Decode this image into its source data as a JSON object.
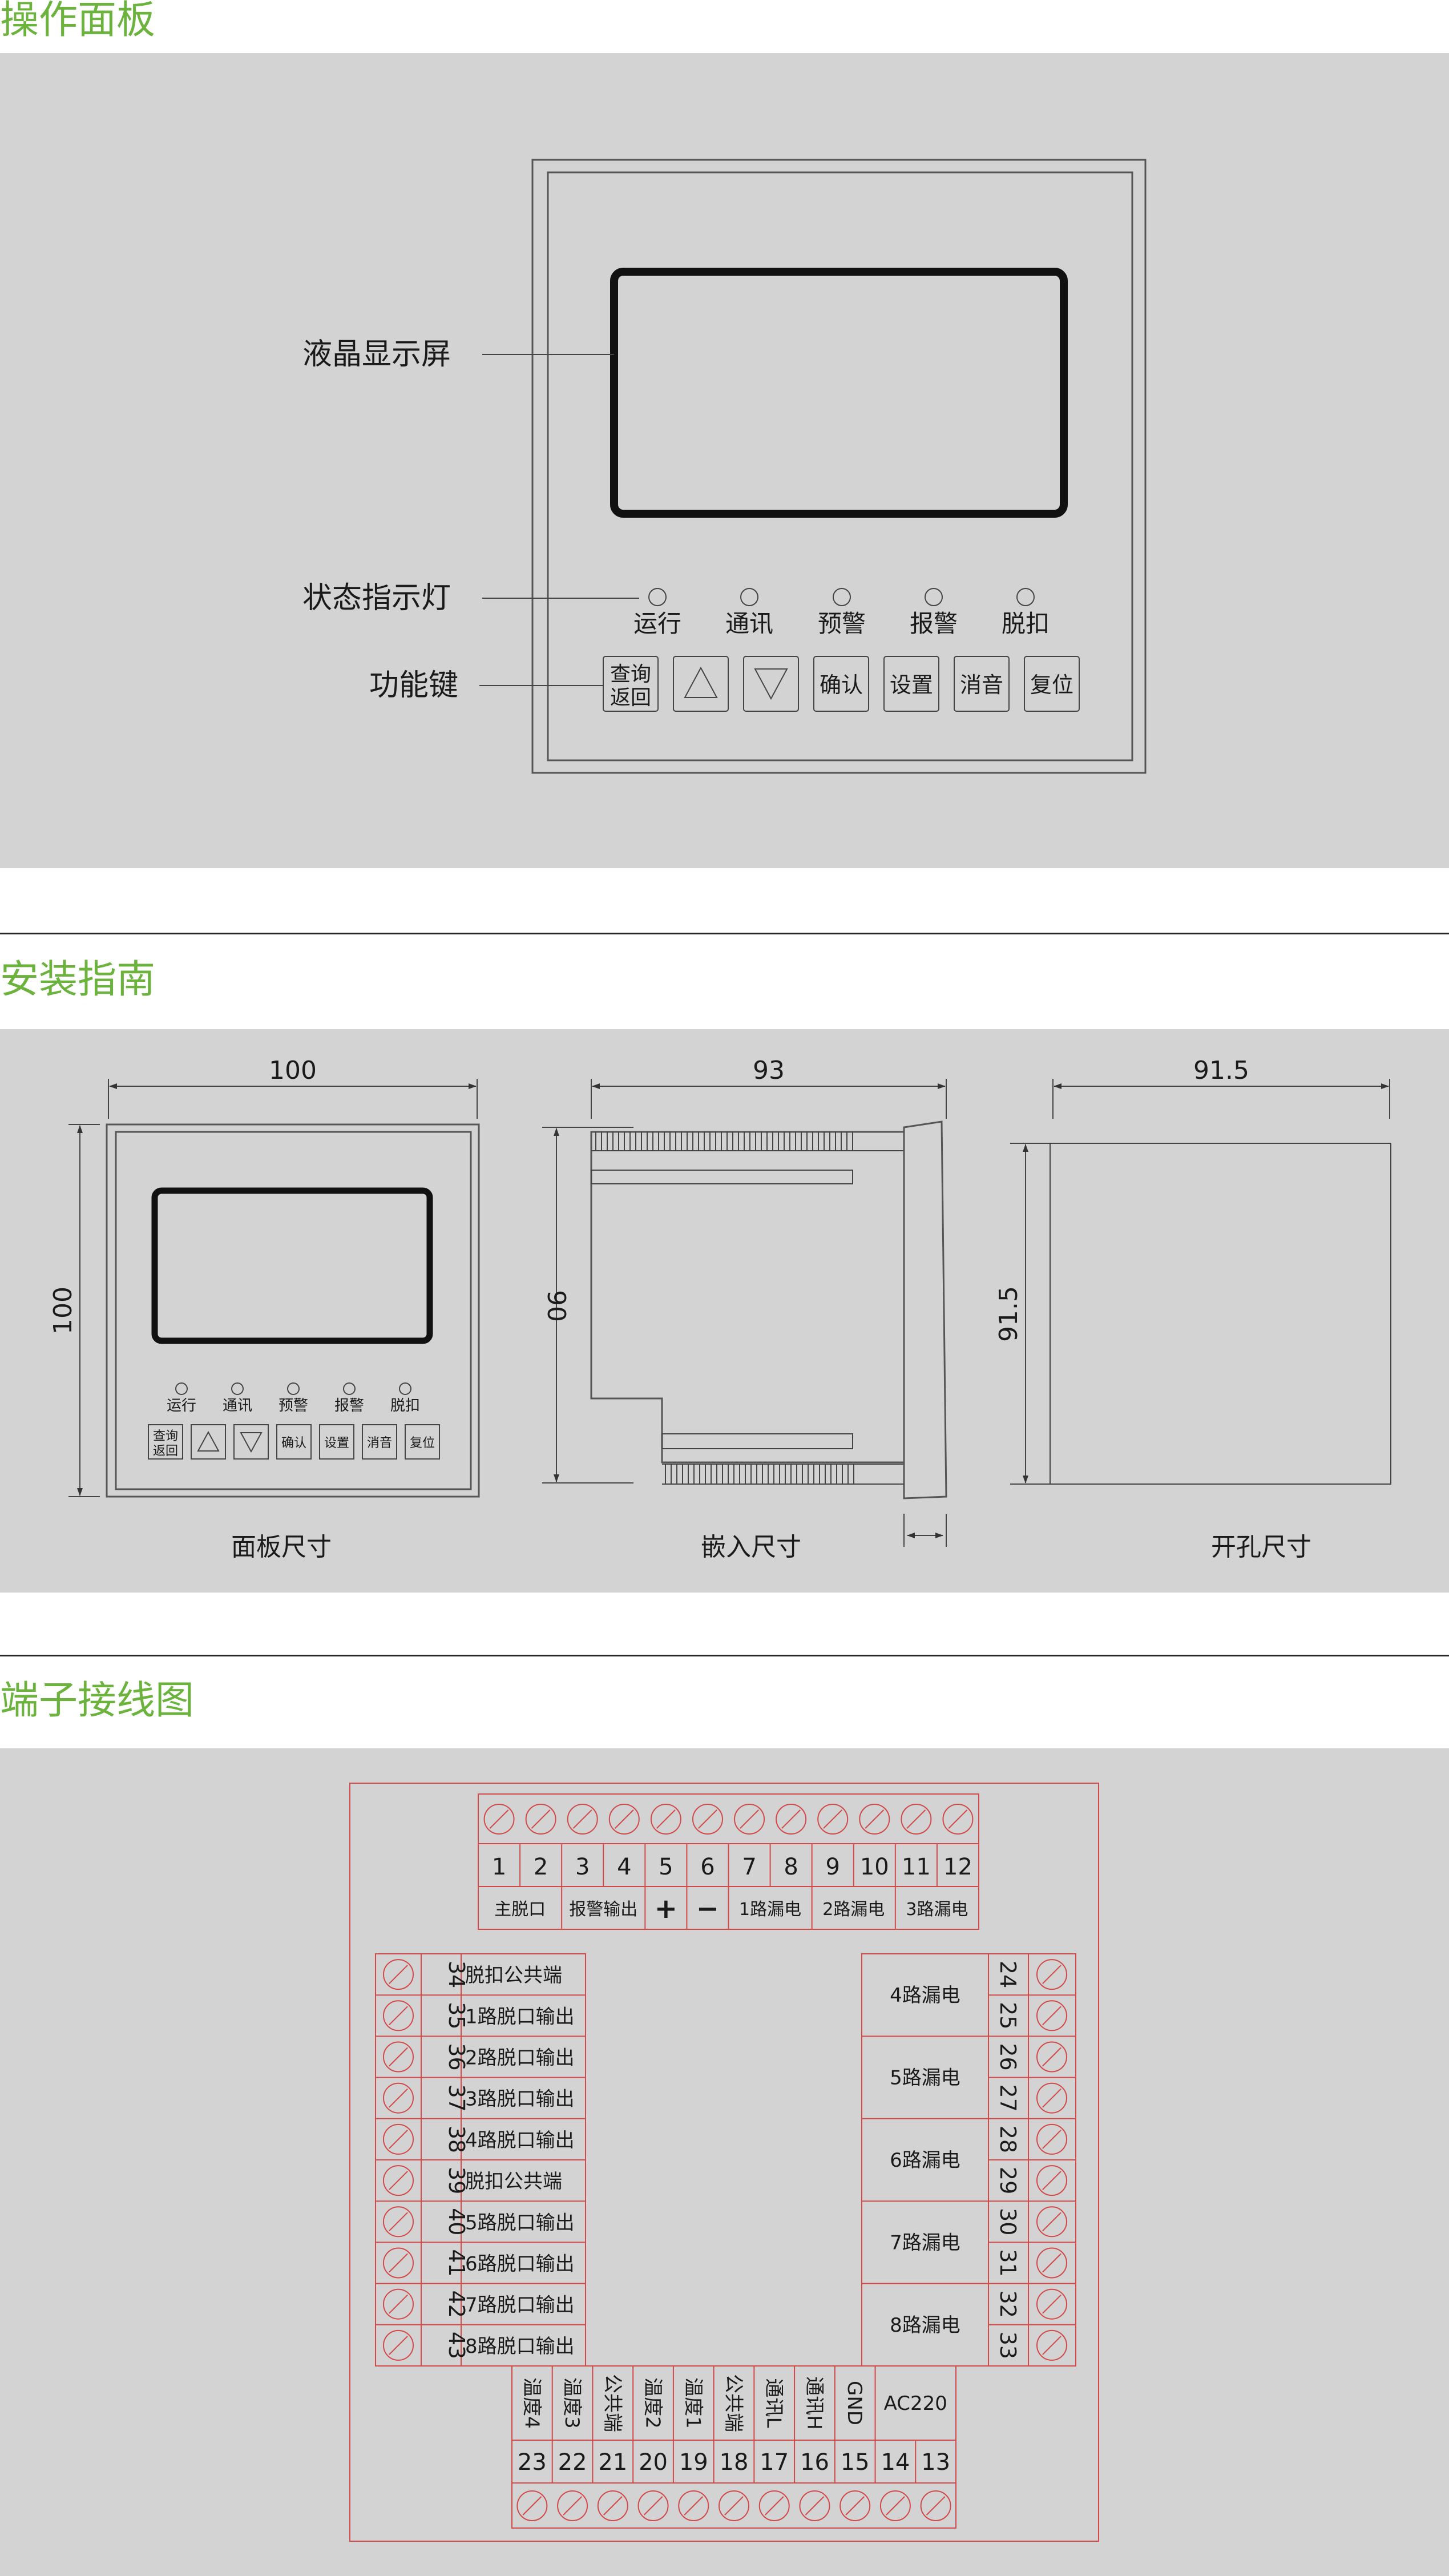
{
  "sections": {
    "panel": "操作面板",
    "install": "安装指南",
    "wiring": "端子接线图"
  },
  "panel": {
    "lcd_label": "液晶显示屏",
    "indicator_label": "状态指示灯",
    "keys_label": "功能键",
    "indicators": [
      "运行",
      "通讯",
      "预警",
      "报警",
      "脱扣"
    ],
    "keys": {
      "query_return": [
        "查询",
        "返回"
      ],
      "up": "△",
      "down": "▽",
      "confirm": "确认",
      "settings": "设置",
      "mute": "消音",
      "reset": "复位"
    }
  },
  "install": {
    "panel_size": {
      "width": "100",
      "height": "100",
      "caption": "面板尺寸"
    },
    "embed_size": {
      "width": "93",
      "height": "90",
      "caption": "嵌入尺寸"
    },
    "cutout_size": {
      "width": "91.5",
      "height": "91.5",
      "caption": "开孔尺寸"
    }
  },
  "wiring": {
    "top_numbers": [
      "1",
      "2",
      "3",
      "4",
      "5",
      "6",
      "7",
      "8",
      "9",
      "10",
      "11",
      "12"
    ],
    "top_groups": [
      "主脱口",
      "报警输出",
      "+",
      "−",
      "1路漏电",
      "2路漏电",
      "3路漏电"
    ],
    "left_rows": [
      {
        "num": "34",
        "label": "脱扣公共端"
      },
      {
        "num": "35",
        "label": "1路脱口输出"
      },
      {
        "num": "36",
        "label": "2路脱口输出"
      },
      {
        "num": "37",
        "label": "3路脱口输出"
      },
      {
        "num": "38",
        "label": "4路脱口输出"
      },
      {
        "num": "39",
        "label": "脱扣公共端"
      },
      {
        "num": "40",
        "label": "5路脱口输出"
      },
      {
        "num": "41",
        "label": "6路脱口输出"
      },
      {
        "num": "42",
        "label": "7路脱口输出"
      },
      {
        "num": "43",
        "label": "8路脱口输出"
      }
    ],
    "right_numbers": [
      "24",
      "25",
      "26",
      "27",
      "28",
      "29",
      "30",
      "31",
      "32",
      "33"
    ],
    "right_groups": [
      "4路漏电",
      "5路漏电",
      "6路漏电",
      "7路漏电",
      "8路漏电"
    ],
    "bottom_labels": [
      "温度4",
      "温度3",
      "公共端",
      "温度2",
      "温度1",
      "公共端",
      "通讯L",
      "通讯H",
      "GND",
      "AC220"
    ],
    "bottom_numbers": [
      "23",
      "22",
      "21",
      "20",
      "19",
      "18",
      "17",
      "16",
      "15",
      "14",
      "13"
    ]
  }
}
